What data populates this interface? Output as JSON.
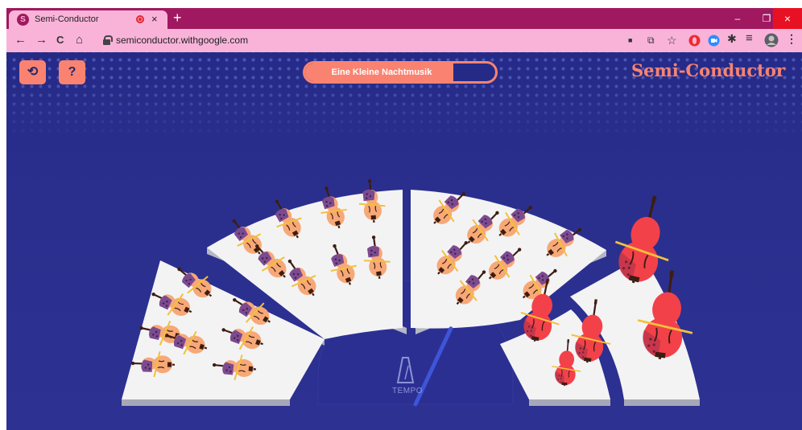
{
  "browser": {
    "tab_title": "Semi-Conductor",
    "tab_favicon": "S",
    "tab_close": "×",
    "new_tab": "+",
    "url": "semiconductor.withgoogle.com",
    "nav": {
      "back": "←",
      "forward": "→",
      "reload": "C",
      "home": "⌂"
    },
    "window": {
      "minimize": "–",
      "restore": "❐",
      "close": "×"
    },
    "toolbar_icons": {
      "camera": "■",
      "translate": "⧉",
      "star": "☆",
      "puzzle": "✱",
      "media": "≡",
      "menu": "⋮"
    }
  },
  "app": {
    "reset_icon": "⟲",
    "help_label": "?",
    "song_title": "Eine Kleine Nachtmusik",
    "song_progress": 0.78,
    "brand_first": "Semi-",
    "brand_second": "Conductor",
    "tempo_label": "TEMPO",
    "tempo_needle_angle_deg": 25
  },
  "colors": {
    "chrome_tab_bar": "#a0185f",
    "chrome_toolbar": "#f9b3d9",
    "page_background": "#2a2f8e",
    "accent": "#f98370",
    "stage_white": "#f3f3f4",
    "violin_body": "#f7a877",
    "cello_body": "#f3414a",
    "tempo_needle": "#3e55d8"
  },
  "instruments": {
    "first_violins": 8,
    "second_violins": 8,
    "violas": 8,
    "cellos": 3,
    "basses": 2
  }
}
